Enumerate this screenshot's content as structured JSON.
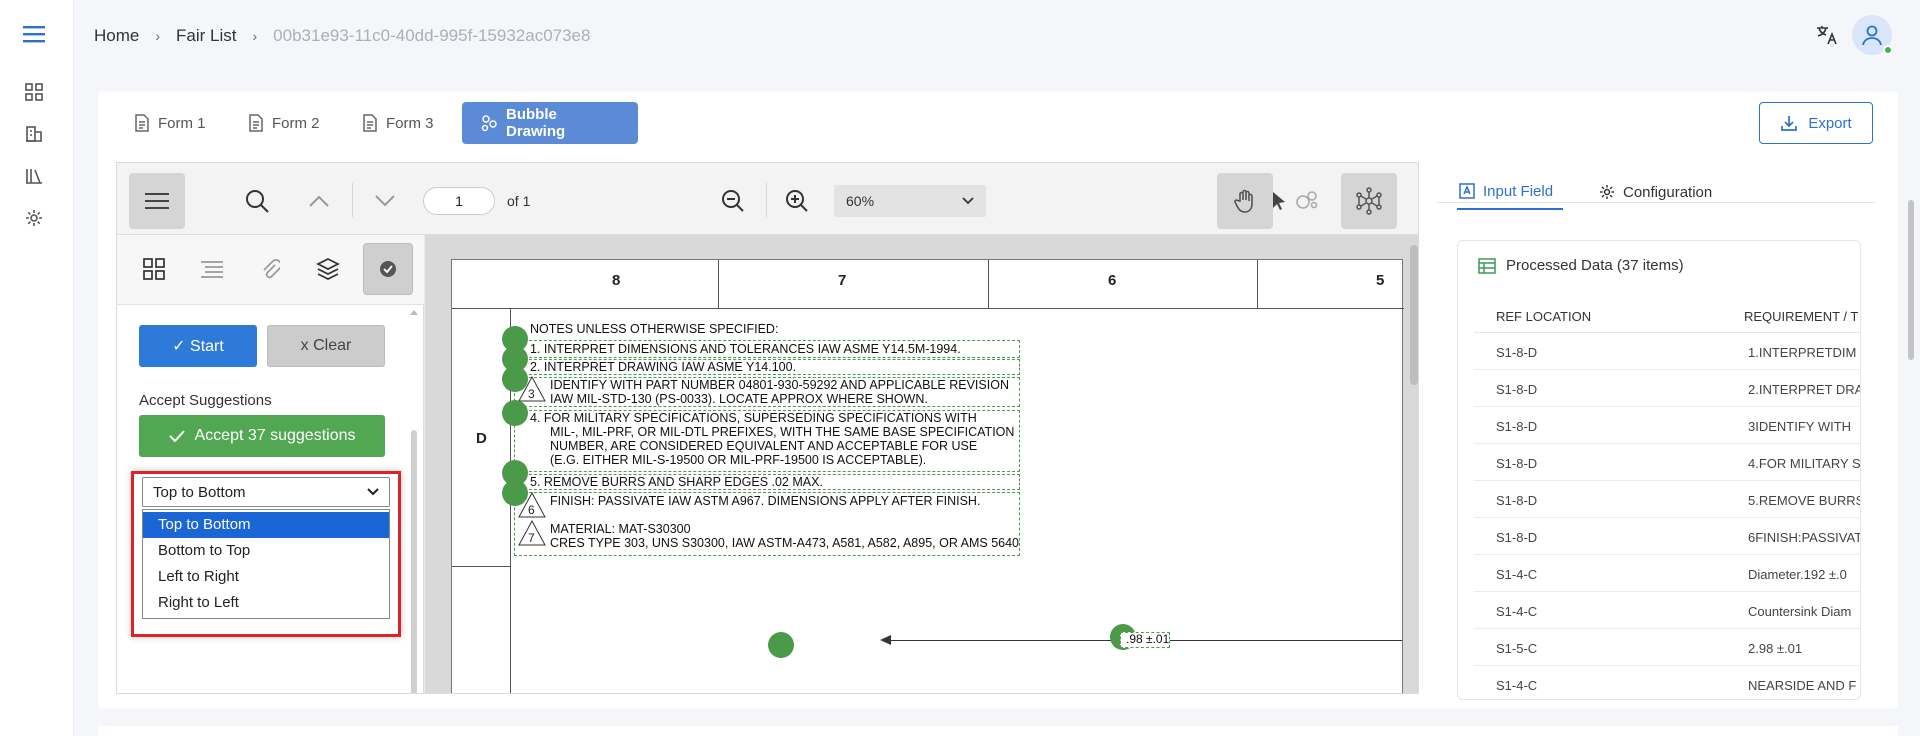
{
  "breadcrumb": {
    "home": "Home",
    "list": "Fair List",
    "current": "00b31e93-11c0-40dd-995f-15932ac073e8"
  },
  "tabs": [
    {
      "label": "Form 1",
      "icon": "document-icon"
    },
    {
      "label": "Form 2",
      "icon": "document-icon"
    },
    {
      "label": "Form 3",
      "icon": "document-icon"
    },
    {
      "label": "Bubble Drawing",
      "icon": "bubble-icon",
      "active": true
    }
  ],
  "export_label": "Export",
  "viewer": {
    "page": "1",
    "of_label": "of 1",
    "zoom": "60%"
  },
  "panel": {
    "start_label": "✓ Start",
    "clear_label": "x Clear",
    "accept_heading": "Accept Suggestions",
    "accept_label": "Accept 37 suggestions",
    "sort_selected": "Top to Bottom",
    "sort_options": [
      "Top to Bottom",
      "Bottom to Top",
      "Left to Right",
      "Right to Left"
    ]
  },
  "drawing": {
    "columns": [
      "8",
      "7",
      "6",
      "5"
    ],
    "row_label": "D",
    "notes_title": "NOTES UNLESS OTHERWISE SPECIFIED:",
    "notes": [
      "1.   INTERPRET DIMENSIONS AND TOLERANCES IAW ASME Y14.5M-1994.",
      "2.   INTERPRET DRAWING IAW ASME Y14.100.",
      "IDENTIFY WITH PART NUMBER 04801-930-59292 AND APPLICABLE REVISION",
      "IAW MIL-STD-130 (PS-0033). LOCATE APPROX WHERE SHOWN.",
      "4.   FOR MILITARY SPECIFICATIONS, SUPERSEDING SPECIFICATIONS WITH",
      "MIL-, MIL-PRF, OR MIL-DTL PREFIXES, WITH THE SAME BASE SPECIFICATION",
      "NUMBER, ARE CONSIDERED EQUIVALENT AND ACCEPTABLE FOR USE",
      "(E.G. EITHER MIL-S-19500 OR MIL-PRF-19500 IS ACCEPTABLE).",
      "5.   REMOVE BURRS AND SHARP EDGES .02 MAX.",
      "FINISH: PASSIVATE IAW ASTM A967. DIMENSIONS APPLY AFTER FINISH.",
      "MATERIAL: MAT-S30300",
      "CRES TYPE 303, UNS S30300, IAW ASTM-A473, A581, A582, A895, OR AMS 5640"
    ],
    "flag_numbers": [
      "3",
      "6",
      "7"
    ],
    "dimension": ".98 ±.01"
  },
  "right_panel": {
    "tabs": [
      "Input Field",
      "Configuration"
    ],
    "data_title": "Processed Data (37 items)",
    "columns": [
      "REF LOCATION",
      "REQUIREMENT / T"
    ],
    "rows": [
      [
        "S1-8-D",
        "1.INTERPRETDIM"
      ],
      [
        "S1-8-D",
        "2.INTERPRET DRA"
      ],
      [
        "S1-8-D",
        "3IDENTIFY WITH"
      ],
      [
        "S1-8-D",
        "4.FOR MILITARY S"
      ],
      [
        "S1-8-D",
        "5.REMOVE BURRS"
      ],
      [
        "S1-8-D",
        "6FINISH:PASSIVAT"
      ],
      [
        "S1-4-C",
        "Diameter.192 ±.0"
      ],
      [
        "S1-4-C",
        "Countersink Diam"
      ],
      [
        "S1-5-C",
        "2.98 ±.01"
      ],
      [
        "S1-4-C",
        "NEARSIDE AND F"
      ]
    ]
  },
  "colors": {
    "accent": "#2e6fcf",
    "tab_active": "#5b8ad6",
    "success": "#52a852",
    "highlight": "#d9242a",
    "bubble": "#4a9a4a"
  }
}
